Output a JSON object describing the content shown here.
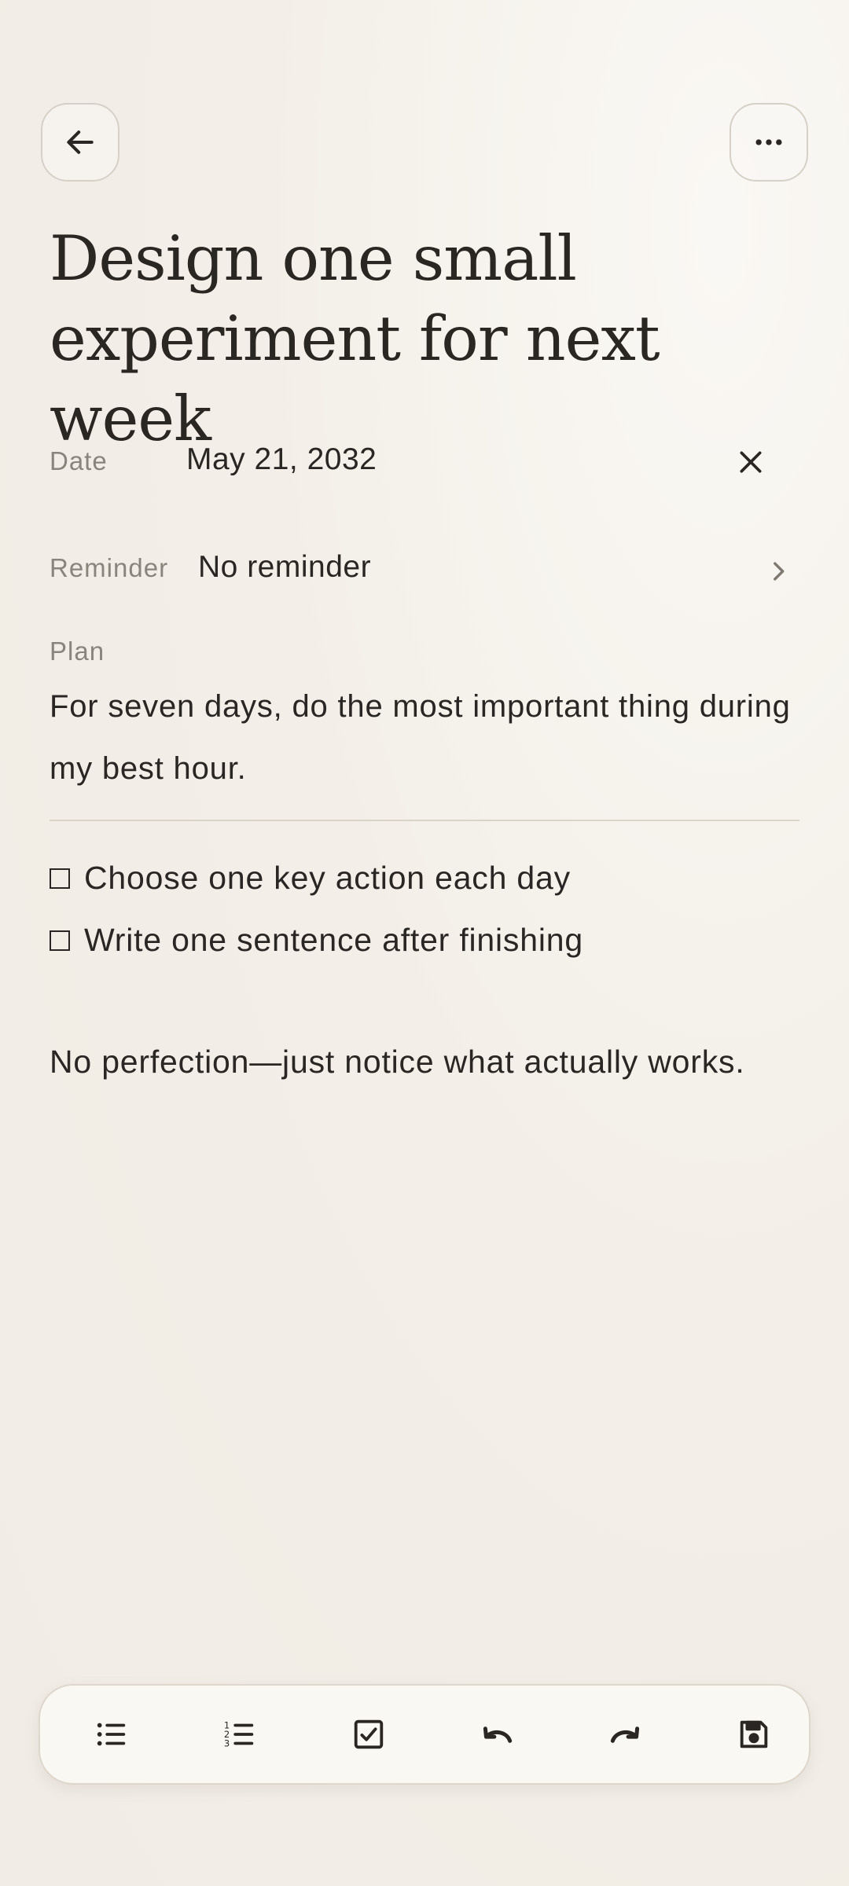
{
  "header": {
    "back_icon": "arrow-left-icon",
    "more_icon": "more-horizontal-icon"
  },
  "note": {
    "title": "Design one small experiment for next week",
    "date_label": "Date",
    "date_value": "May 21, 2032",
    "clear_date_icon": "close-icon",
    "reminder_label": "Reminder",
    "reminder_value": "No reminder",
    "reminder_icon": "chevron-right-icon",
    "plan_label": "Plan",
    "plan_text": "For seven days, do the most important thing during my best hour.",
    "checklist": [
      {
        "text": "Choose one key action each day",
        "checked": false
      },
      {
        "text": "Write one sentence after finishing",
        "checked": false
      }
    ],
    "closing_text": "No perfection—just notice what actually works."
  },
  "toolbar": {
    "items": [
      {
        "icon": "bulleted-list-icon"
      },
      {
        "icon": "numbered-list-icon"
      },
      {
        "icon": "checkbox-icon"
      },
      {
        "icon": "undo-icon"
      },
      {
        "icon": "redo-icon"
      },
      {
        "icon": "save-icon"
      }
    ]
  },
  "colors": {
    "background": "#f2eee7",
    "text": "#2a2623",
    "muted": "#8a857c",
    "border": "#d6d1c8"
  }
}
